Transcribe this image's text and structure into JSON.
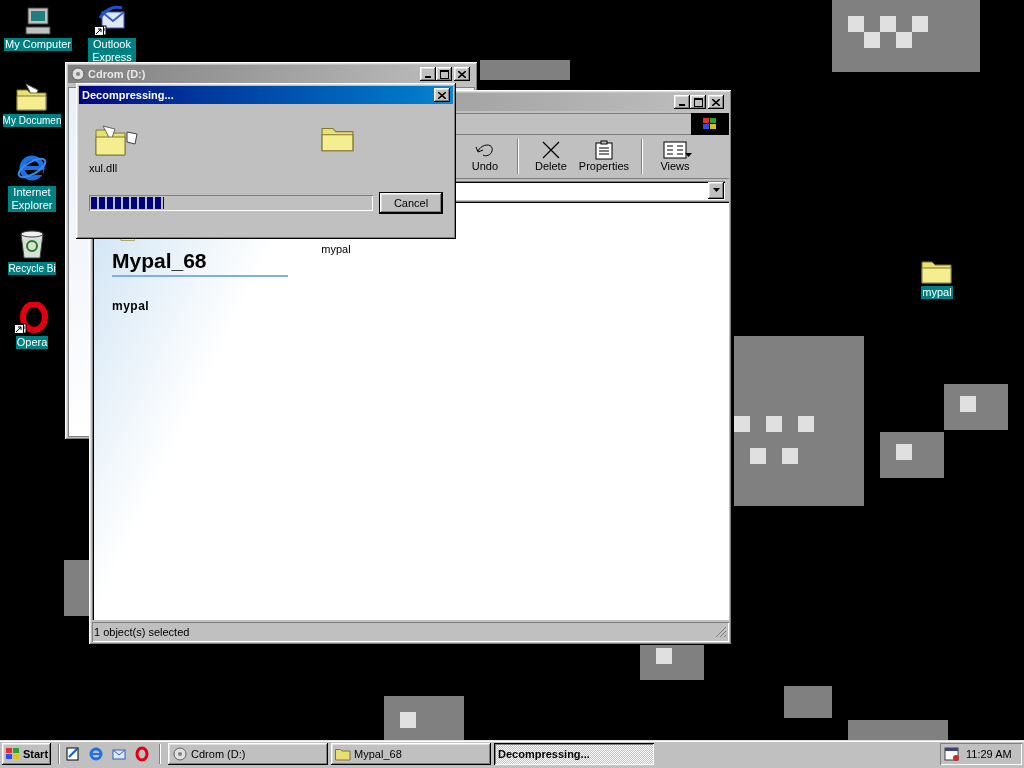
{
  "desktop_icons": [
    {
      "label": "My Computer",
      "kind": "computer",
      "shortcut": false
    },
    {
      "label": "Outlook Express",
      "kind": "mail",
      "shortcut": true
    },
    {
      "label": "My Documen",
      "kind": "documents",
      "shortcut": false
    },
    {
      "label": "Internet Explorer",
      "kind": "browser",
      "shortcut": false
    },
    {
      "label": "Recycle Bi",
      "kind": "recycle",
      "shortcut": false
    },
    {
      "label": "Opera",
      "kind": "opera",
      "shortcut": true
    },
    {
      "label": "mypal",
      "kind": "folder",
      "shortcut": false
    }
  ],
  "background_window": {
    "title": "Cdrom (D:)"
  },
  "explorer_window": {
    "toolbar": [
      {
        "label": "Undo",
        "kind": "undo"
      },
      {
        "label": "Delete",
        "kind": "delete"
      },
      {
        "label": "Properties",
        "kind": "properties"
      },
      {
        "label": "Views",
        "kind": "views"
      }
    ],
    "folder_heading": "Mypal_68",
    "folder_subtitle": "mypal",
    "items": [
      {
        "label": "mypal"
      }
    ],
    "status_bar": "1 object(s) selected"
  },
  "dialog": {
    "title": "Decompressing...",
    "file_name": "xul.dll",
    "progress": {
      "level": 0.26
    },
    "buttons": [
      "Cancel"
    ]
  },
  "taskbar": {
    "start": "Start",
    "tasks": [
      {
        "label": "Cdrom (D:)",
        "kind": "cdrom",
        "selected": false
      },
      {
        "label": "Mypal_68",
        "kind": "folder",
        "selected": false
      },
      {
        "label": "Decompressing...",
        "kind": "none",
        "selected": true
      }
    ],
    "clock": "11:29 AM"
  }
}
